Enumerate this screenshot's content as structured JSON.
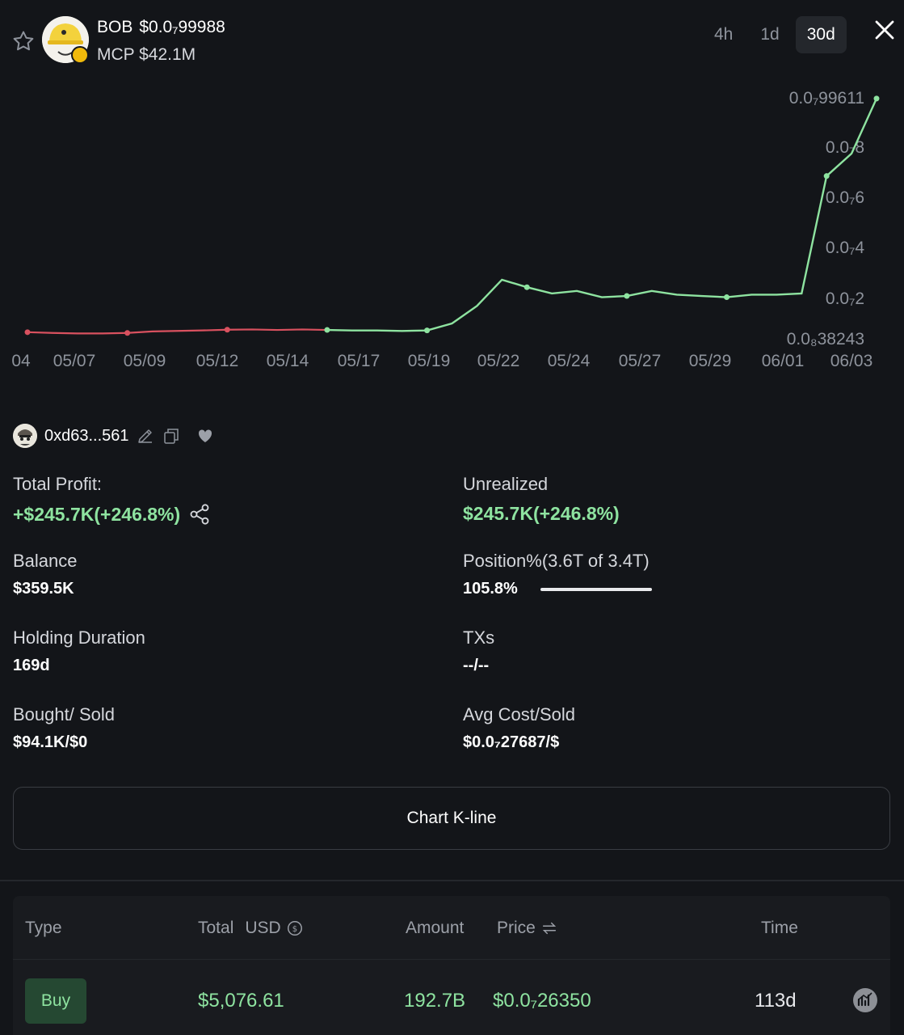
{
  "header": {
    "token_symbol": "BOB",
    "token_price": "$0.0₇99988",
    "mcp": "MCP $42.1M",
    "timeframes": [
      "4h",
      "1d",
      "30d"
    ],
    "active_timeframe": "30d"
  },
  "chart_data": {
    "type": "line",
    "x_tick_labels": [
      "04",
      "05/07",
      "05/09",
      "05/12",
      "05/14",
      "05/17",
      "05/19",
      "05/22",
      "05/24",
      "05/27",
      "05/29",
      "06/01",
      "06/03"
    ],
    "y_tick_labels": [
      "0.0₇99611",
      "0.0₇8",
      "0.0₇6",
      "0.0₇4",
      "0.0₇2",
      "0.0₈38243"
    ],
    "ylim": [
      0.38243,
      9.9611
    ],
    "y_unit_note": "values in units of 1e-8",
    "series": [
      {
        "x": [
          0,
          1,
          2,
          3,
          4,
          5,
          6,
          7,
          8,
          9,
          10,
          11,
          12,
          13,
          14,
          15,
          16,
          17,
          18,
          19,
          20,
          21,
          22,
          23,
          24,
          25,
          26,
          27,
          28,
          29,
          30,
          31,
          32,
          33,
          34
        ],
        "y": [
          0.55,
          0.52,
          0.5,
          0.5,
          0.52,
          0.58,
          0.6,
          0.62,
          0.65,
          0.66,
          0.64,
          0.66,
          0.64,
          0.62,
          0.62,
          0.6,
          0.62,
          0.9,
          1.6,
          2.65,
          2.35,
          2.1,
          2.2,
          1.95,
          2.0,
          2.2,
          2.05,
          2.0,
          1.95,
          2.05,
          2.05,
          2.1,
          6.8,
          7.7,
          9.9
        ]
      }
    ],
    "colors": {
      "up": "#8ee3a0",
      "down": "#d9515f"
    },
    "buy_marker_value": 0.55
  },
  "wallet": {
    "address": "0xd63...561"
  },
  "stats": {
    "total_profit_label": "Total Profit:",
    "total_profit_value": "+$245.7K(+246.8%)",
    "unrealized_label": "Unrealized",
    "unrealized_value": "$245.7K(+246.8%)",
    "balance_label": "Balance",
    "balance_value": "$359.5K",
    "position_label": "Position%(3.6T of 3.4T)",
    "position_value": "105.8%",
    "position_fraction": 1.0,
    "holding_label": "Holding Duration",
    "holding_value": "169d",
    "txs_label": "TXs",
    "txs_value": "--/--",
    "bought_sold_label": "Bought/ Sold",
    "bought_sold_value": "$94.1K/$0",
    "avg_cost_label": "Avg Cost/Sold",
    "avg_cost_value": "$0.0₇27687/$"
  },
  "kline_button": "Chart K-line",
  "table": {
    "headers": {
      "type": "Type",
      "total": "Total",
      "usd": "USD",
      "amount": "Amount",
      "price": "Price",
      "time": "Time"
    },
    "rows": [
      {
        "type": "Buy",
        "total": "$5,076.61",
        "amount": "192.7B",
        "price": "$0.0₇26350",
        "time": "113d"
      }
    ]
  },
  "colors": {
    "accent_green": "#8ee3a0",
    "accent_red": "#d9515f",
    "background": "#131519"
  }
}
